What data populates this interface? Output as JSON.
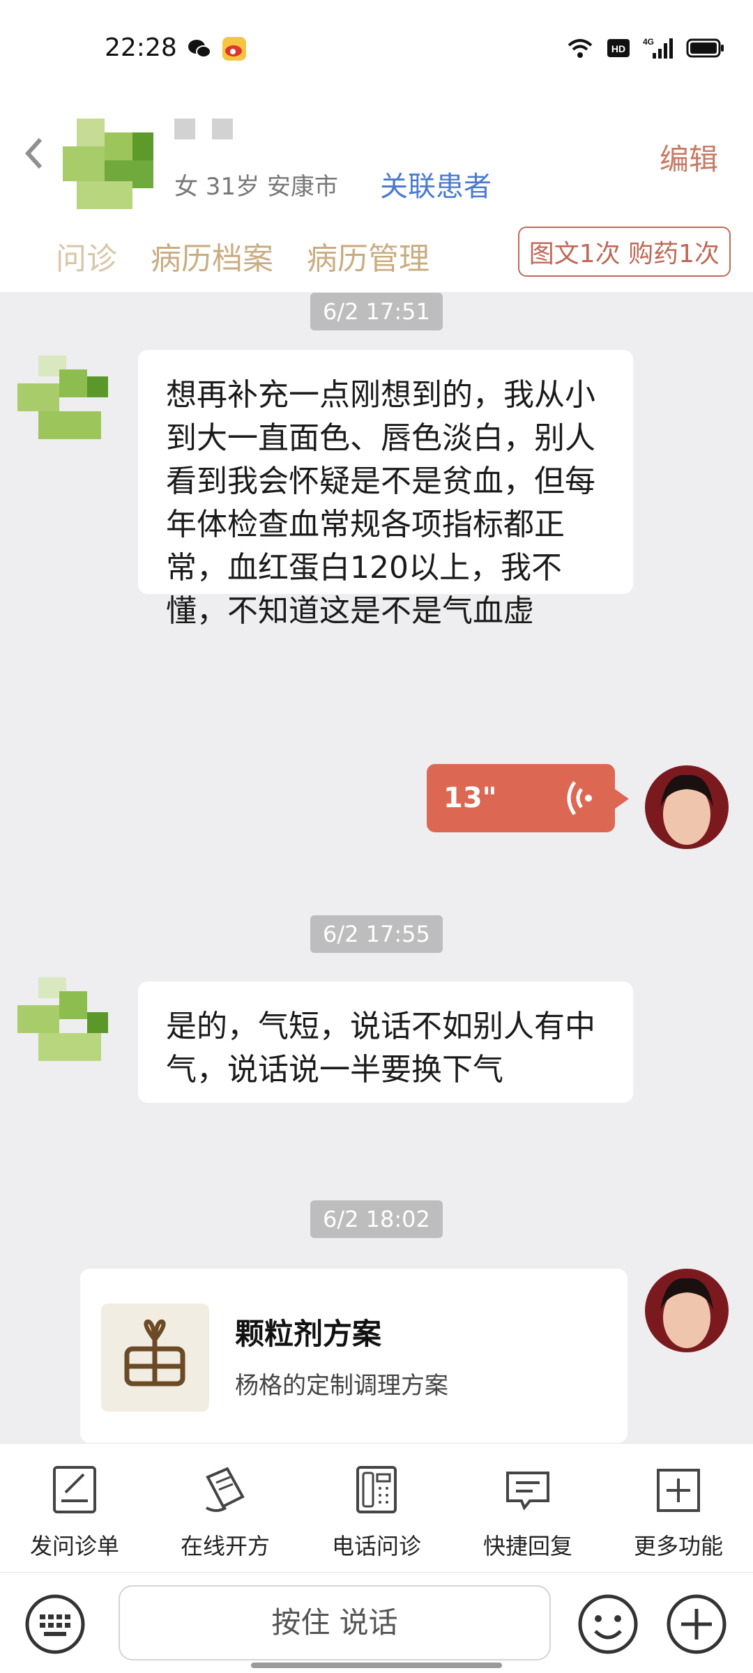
{
  "status_bar": {
    "time": "22:28",
    "network": "4G"
  },
  "header": {
    "patient_info": "女 31岁  安康市",
    "link_patient": "关联患者",
    "edit": "编辑",
    "tabs": [
      "问诊",
      "病历档案",
      "病历管理"
    ],
    "badge": "图文1次 购药1次"
  },
  "chat": {
    "messages": [
      {
        "timestamp": "6/2 17:51",
        "text": "想再补充一点刚想到的，我从小到大一直面色、唇色淡白，别人看到我会怀疑是不是贫血，但每年体检查血常规各项指标都正常，血红蛋白120以上，我不懂，不知道这是不是气血虚"
      },
      {
        "voice_duration": "13\""
      },
      {
        "timestamp": "6/2 17:55",
        "text": "是的，气短，说话不如别人有中气，说话说一半要换下气"
      },
      {
        "timestamp": "6/2 18:02",
        "card_title": "颗粒剂方案",
        "card_subtitle": "杨格的定制调理方案"
      }
    ]
  },
  "toolbar": {
    "items": [
      {
        "label": "发问诊单",
        "icon": "form-edit-icon"
      },
      {
        "label": "在线开方",
        "icon": "prescription-icon"
      },
      {
        "label": "电话问诊",
        "icon": "phone-icon"
      },
      {
        "label": "快捷回复",
        "icon": "quick-reply-icon"
      },
      {
        "label": "更多功能",
        "icon": "plus-square-icon"
      }
    ]
  },
  "input": {
    "hold_to_talk": "按住 说话"
  },
  "colors": {
    "accent": "#dc6853",
    "link": "#4a7bd0",
    "tab": "#c9ad82",
    "badge": "#c06856"
  }
}
